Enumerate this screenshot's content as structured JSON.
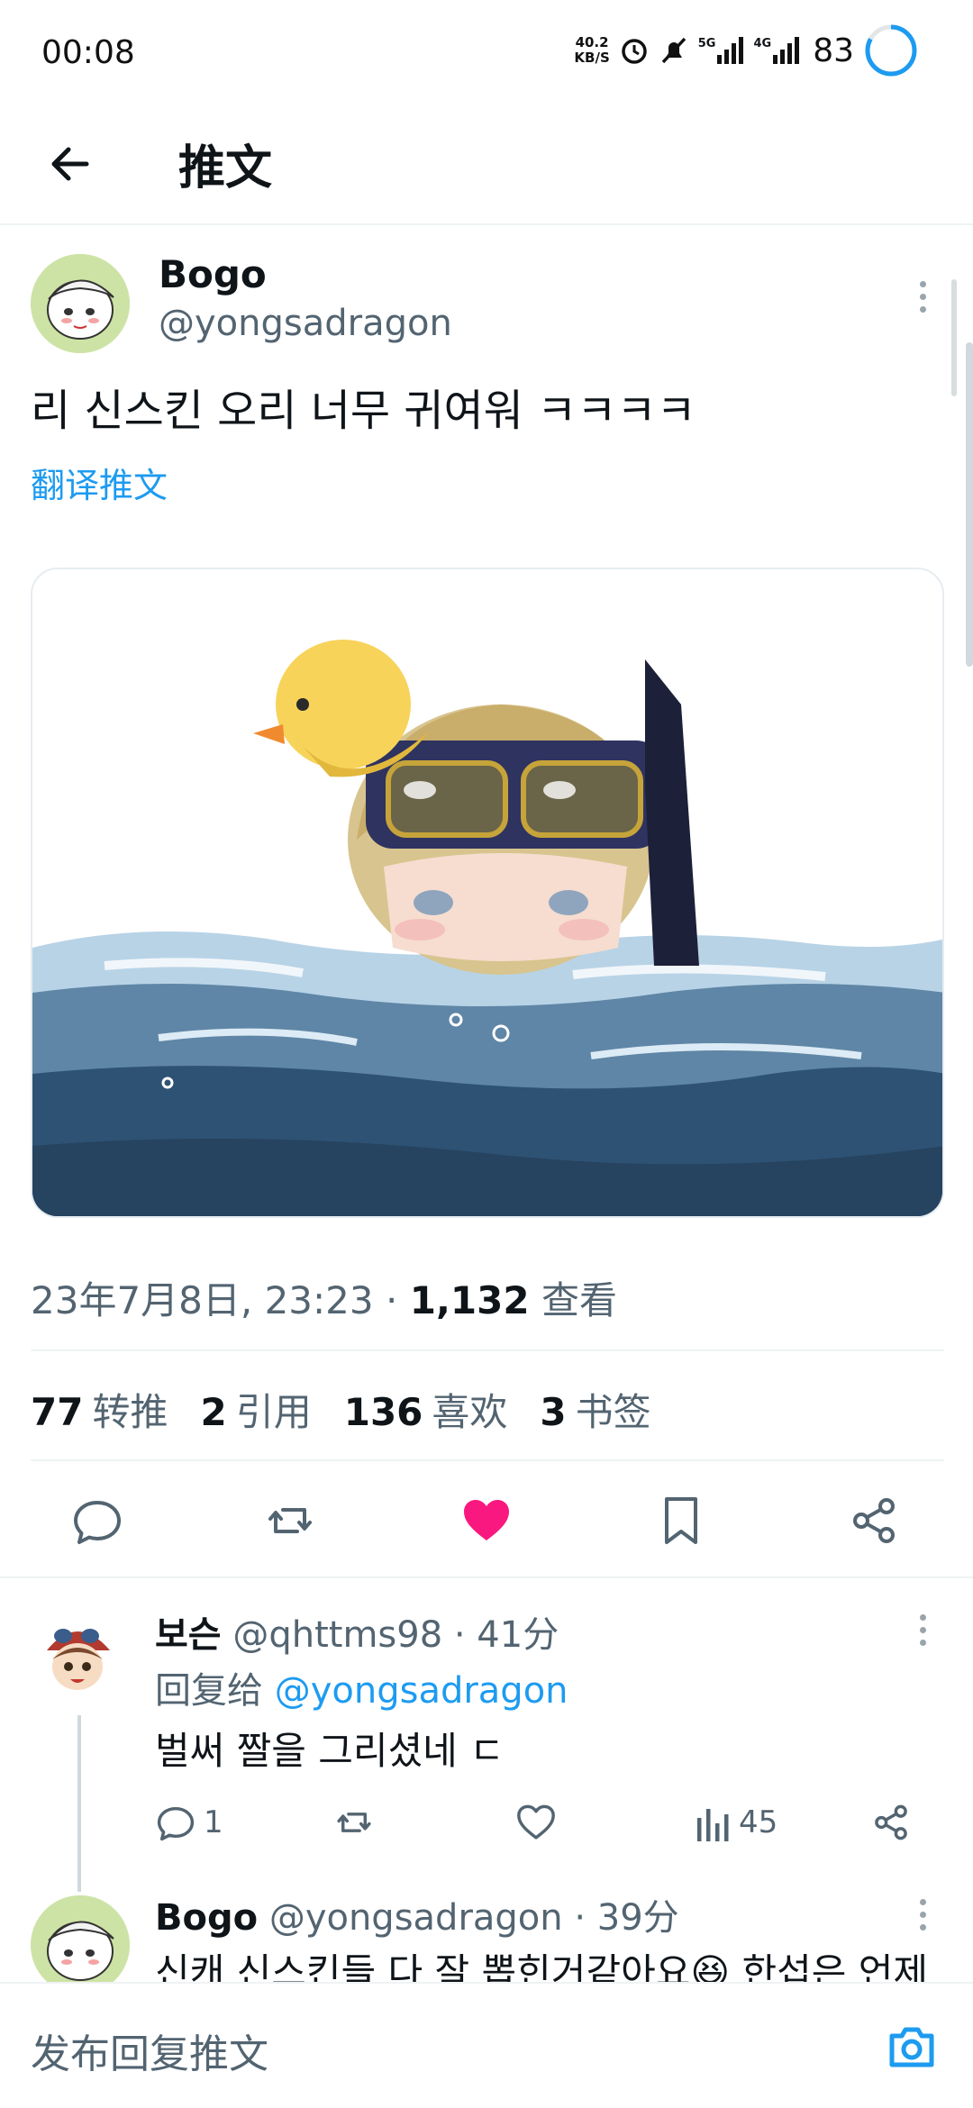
{
  "status_bar": {
    "time": "00:08",
    "net_speed_value": "40.2",
    "net_speed_unit": "KB/S",
    "signal_1": "5G",
    "signal_2": "4G",
    "battery": "83"
  },
  "header": {
    "title": "推文",
    "back_icon": "arrow-left-icon"
  },
  "tweet": {
    "author_name": "Bogo",
    "author_handle": "@yongsadragon",
    "text": "리 신스킨 오리 너무 귀여워 ㅋㅋㅋㅋ",
    "translate_label": "翻译推文",
    "timestamp": "23年7月8日, 23:23",
    "separator": "·",
    "views_count": "1,132",
    "views_label": "查看",
    "stats": {
      "retweets_count": "77",
      "retweets_label": "转推",
      "quotes_count": "2",
      "quotes_label": "引用",
      "likes_count": "136",
      "likes_label": "喜欢",
      "bookmarks_count": "3",
      "bookmarks_label": "书签"
    },
    "liked": true
  },
  "replies": [
    {
      "author_name": "보슨",
      "author_handle": "@qhttms98",
      "time": "· 41分",
      "reply_to_prefix": "回复给",
      "reply_to_handle": "@yongsadragon",
      "text": "벌써 짤을 그리셨네 ㄷ",
      "reply_count": "1",
      "views_count": "45"
    },
    {
      "author_name": "Bogo",
      "author_handle": "@yongsadragon",
      "time": "· 39分",
      "text": "신캐 신스킨들 다 잘 뽑힌거같아요😆 한섭은 언제"
    }
  ],
  "compose": {
    "placeholder": "发布回复推文",
    "camera_icon": "camera-icon"
  },
  "colors": {
    "accent": "#1d9bf0",
    "like": "#f91880",
    "secondary_text": "#536471",
    "primary_text": "#0f1419"
  }
}
